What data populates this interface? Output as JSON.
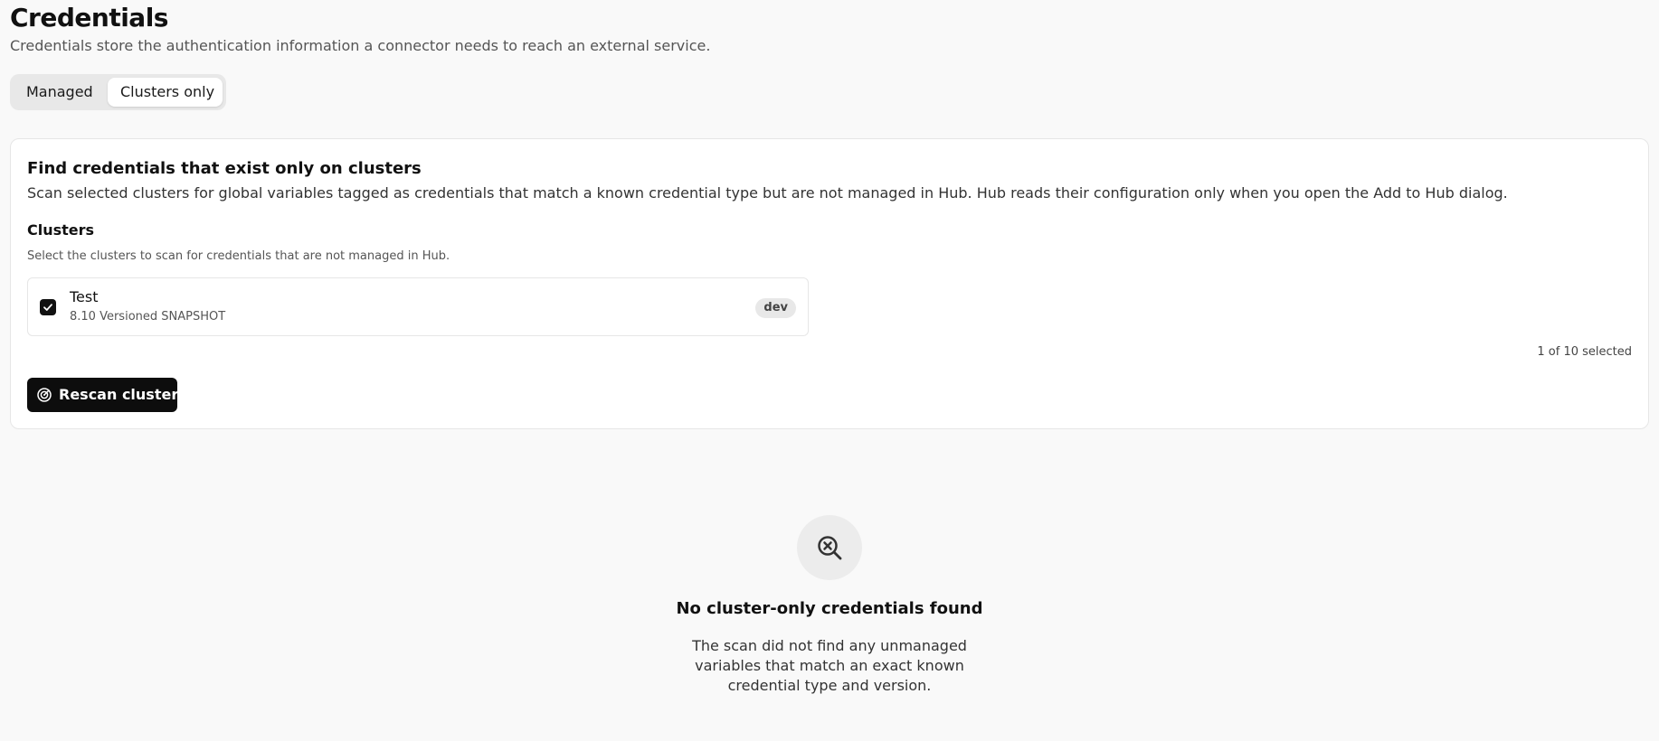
{
  "header": {
    "title": "Credentials",
    "subtitle": "Credentials store the authentication information a connector needs to reach an external service."
  },
  "tabs": [
    {
      "label": "Managed",
      "active": false
    },
    {
      "label": "Clusters only",
      "active": true
    }
  ],
  "scan_card": {
    "title": "Find credentials that exist only on clusters",
    "description": "Scan selected clusters for global variables tagged as credentials that match a known credential type but are not managed in Hub. Hub reads their configuration only when you open the Add to Hub dialog.",
    "clusters_label": "Clusters",
    "clusters_help": "Select the clusters to scan for credentials that are not managed in Hub.",
    "clusters": [
      {
        "name": "Test",
        "version": "8.10 Versioned SNAPSHOT",
        "badge": "dev",
        "checked": true
      }
    ],
    "selected_count": "1 of 10 selected",
    "rescan_label": "Rescan clusters",
    "rescan_icon": "radar-icon"
  },
  "empty_state": {
    "icon": "search-x-icon",
    "title": "No cluster-only credentials found",
    "description": "The scan did not find any unmanaged variables that match an exact known credential type and version."
  },
  "colors": {
    "background": "#f9f9f9",
    "card": "#ffffff",
    "primary_button": "#0d0d0d",
    "segment_track": "#e8e8e8",
    "badge": "#e8e8e8"
  }
}
